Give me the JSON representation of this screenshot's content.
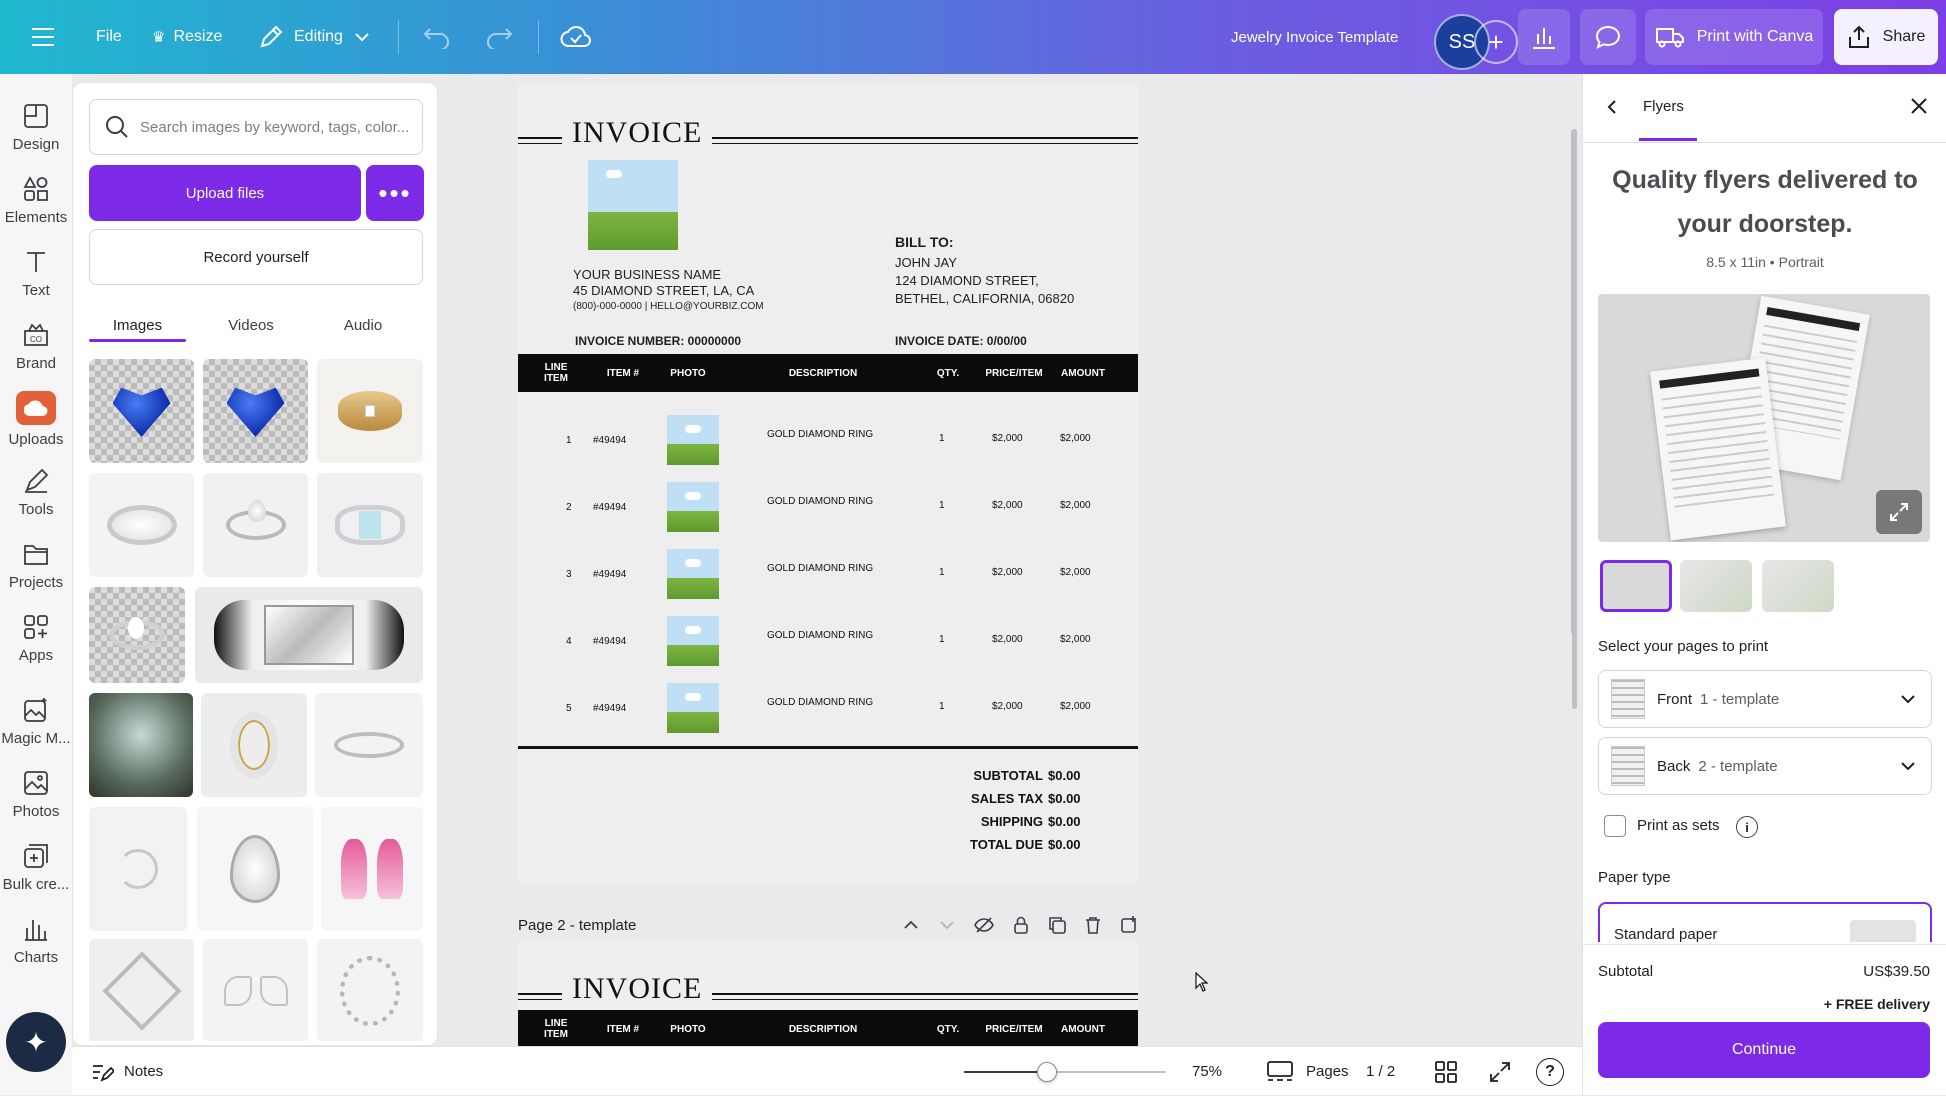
{
  "topbar": {
    "file_label": "File",
    "resize_label": "Resize",
    "editing_label": "Editing",
    "doc_title": "Jewelry Invoice Template",
    "avatar_initials": "SS",
    "print_label": "Print with Canva",
    "share_label": "Share"
  },
  "rail": {
    "items": [
      {
        "label": "Design",
        "icon": "design-icon"
      },
      {
        "label": "Elements",
        "icon": "elements-icon"
      },
      {
        "label": "Text",
        "icon": "text-icon"
      },
      {
        "label": "Brand",
        "icon": "brand-icon"
      },
      {
        "label": "Uploads",
        "icon": "uploads-icon"
      },
      {
        "label": "Tools",
        "icon": "tools-icon"
      },
      {
        "label": "Projects",
        "icon": "projects-icon"
      },
      {
        "label": "Apps",
        "icon": "apps-icon"
      },
      {
        "label": "Magic M...",
        "icon": "magic-media-icon"
      },
      {
        "label": "Photos",
        "icon": "photos-icon"
      },
      {
        "label": "Bulk cre...",
        "icon": "bulk-create-icon"
      },
      {
        "label": "Charts",
        "icon": "charts-icon"
      }
    ]
  },
  "panel": {
    "search_placeholder": "Search images by keyword, tags, color...",
    "upload_label": "Upload files",
    "more_label": "•••",
    "record_label": "Record yourself",
    "tabs": [
      "Images",
      "Videos",
      "Audio"
    ],
    "active_tab": "Images"
  },
  "invoice": {
    "title": "INVOICE",
    "business_name": "YOUR BUSINESS NAME",
    "business_address": "45 DIAMOND STREET, LA, CA",
    "business_contact": "(800)-000-0000 | HELLO@YOURBIZ.COM",
    "bill_to_label": "BILL TO:",
    "bill_name": "JOHN JAY",
    "bill_street": "124 DIAMOND STREET,",
    "bill_city": "BETHEL, CALIFORNIA, 06820",
    "invoice_number": "INVOICE NUMBER: 00000000",
    "invoice_date": "INVOICE DATE: 0/00/00",
    "headers": {
      "line_item": "LINE ITEM",
      "item_no": "ITEM #",
      "photo": "PHOTO",
      "description": "DESCRIPTION",
      "qty": "QTY.",
      "price": "PRICE/ITEM",
      "amount": "AMOUNT"
    },
    "rows": [
      {
        "line": "1",
        "item": "#49494",
        "desc": "GOLD DIAMOND RING",
        "qty": "1",
        "price": "$2,000",
        "amount": "$2,000"
      },
      {
        "line": "2",
        "item": "#49494",
        "desc": "GOLD DIAMOND RING",
        "qty": "1",
        "price": "$2,000",
        "amount": "$2,000"
      },
      {
        "line": "3",
        "item": "#49494",
        "desc": "GOLD DIAMOND RING",
        "qty": "1",
        "price": "$2,000",
        "amount": "$2,000"
      },
      {
        "line": "4",
        "item": "#49494",
        "desc": "GOLD DIAMOND RING",
        "qty": "1",
        "price": "$2,000",
        "amount": "$2,000"
      },
      {
        "line": "5",
        "item": "#49494",
        "desc": "GOLD DIAMOND RING",
        "qty": "1",
        "price": "$2,000",
        "amount": "$2,000"
      }
    ],
    "totals": [
      {
        "label": "SUBTOTAL",
        "value": "$0.00"
      },
      {
        "label": "SALES TAX",
        "value": "$0.00"
      },
      {
        "label": "SHIPPING",
        "value": "$0.00"
      },
      {
        "label": "TOTAL DUE",
        "value": "$0.00"
      }
    ]
  },
  "page2": {
    "label": "Page 2 - template"
  },
  "right_panel": {
    "title": "Flyers",
    "headline": "Quality flyers delivered to your doorstep.",
    "spec": "8.5 x 11in • Portrait",
    "select_pages_label": "Select your pages to print",
    "front_label": "Front",
    "front_sub": "1 - template",
    "back_label": "Back",
    "back_sub": "2 - template",
    "print_sets_label": "Print as sets",
    "paper_type_label": "Paper type",
    "paper_option": "Standard paper",
    "subtotal_label": "Subtotal",
    "subtotal_value": "US$39.50",
    "delivery_label": "+ FREE delivery",
    "continue_label": "Continue"
  },
  "bottombar": {
    "notes_label": "Notes",
    "zoom_value": 75,
    "zoom_label": "75%",
    "pages_label": "Pages",
    "page_counter": "1 / 2"
  },
  "colors": {
    "accent": "#7d2ae8",
    "gradient_start": "#1fb8cf",
    "gradient_end": "#7d3fe6"
  }
}
